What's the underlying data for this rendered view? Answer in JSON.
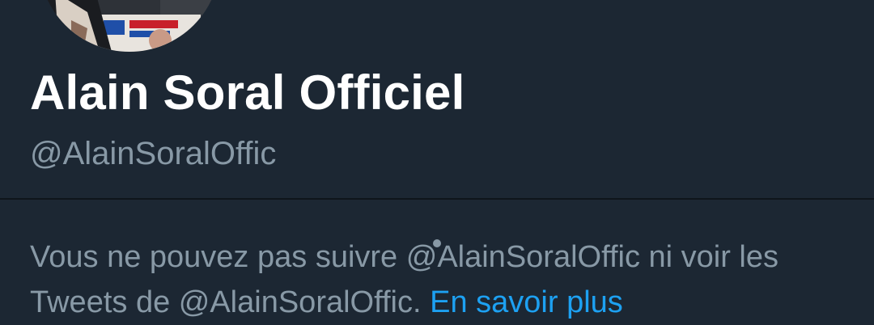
{
  "profile": {
    "name": "Alain Soral Officiel",
    "handle": "@AlainSoralOffic"
  },
  "notice": {
    "line1": "Vous ne pouvez pas suivre @AlainSoralOffic ni voir les",
    "line2_prefix": "Tweets de @AlainSoralOffic.",
    "link_text": "En savoir plus"
  },
  "colors": {
    "background": "#1c2733",
    "name": "#ffffff",
    "secondary_text": "#8899a6",
    "link": "#1da1f2",
    "divider": "#0f151b"
  }
}
